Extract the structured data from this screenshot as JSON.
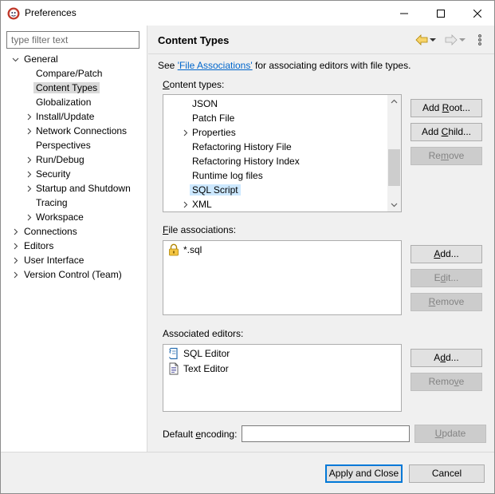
{
  "window": {
    "title": "Preferences",
    "icon": "eclipse-icon"
  },
  "filter": {
    "placeholder": "type filter text"
  },
  "tree": {
    "general": "General",
    "compare_patch": "Compare/Patch",
    "content_types": "Content Types",
    "globalization": "Globalization",
    "install_update": "Install/Update",
    "network_connections": "Network Connections",
    "perspectives": "Perspectives",
    "run_debug": "Run/Debug",
    "security": "Security",
    "startup_shutdown": "Startup and Shutdown",
    "tracing": "Tracing",
    "workspace": "Workspace",
    "connections": "Connections",
    "editors": "Editors",
    "user_interface": "User Interface",
    "version_control": "Version Control (Team)"
  },
  "page": {
    "title": "Content Types",
    "see_prefix": "See ",
    "see_link": "'File Associations'",
    "see_suffix": " for associating editors with file types."
  },
  "content_types": {
    "label_mnemonic": "C",
    "label_rest": "ontent types:",
    "items": [
      "JSON",
      "Patch File",
      "Properties",
      "Refactoring History File",
      "Refactoring History Index",
      "Runtime log files",
      "SQL Script",
      "XML"
    ],
    "selected": "SQL Script",
    "add_root": {
      "a": "Add ",
      "m": "R",
      "b": "oot..."
    },
    "add_child": {
      "a": "Add ",
      "m": "C",
      "b": "hild..."
    },
    "remove": {
      "a": "Re",
      "m": "m",
      "b": "ove"
    }
  },
  "file_associations": {
    "label_mnemonic": "F",
    "label_rest": "ile associations:",
    "items": [
      "*.sql"
    ],
    "add": {
      "a": "",
      "m": "A",
      "b": "dd..."
    },
    "edit": {
      "a": "E",
      "m": "d",
      "b": "it..."
    },
    "remove": {
      "a": "",
      "m": "R",
      "b": "emove"
    }
  },
  "associated_editors": {
    "label": "Associated editors:",
    "items": [
      "SQL Editor",
      "Text Editor"
    ],
    "add": {
      "a": "A",
      "m": "d",
      "b": "d..."
    },
    "remove": {
      "a": "Remo",
      "m": "v",
      "b": "e"
    }
  },
  "encoding": {
    "label_a": "Default ",
    "label_m": "e",
    "label_b": "ncoding:",
    "value": "",
    "update": {
      "a": "",
      "m": "U",
      "b": "pdate"
    }
  },
  "footer": {
    "apply_close": "Apply and Close",
    "cancel": "Cancel"
  },
  "colors": {
    "accent": "#0078d7",
    "link": "#0066cc",
    "selection": "#cce8ff"
  }
}
